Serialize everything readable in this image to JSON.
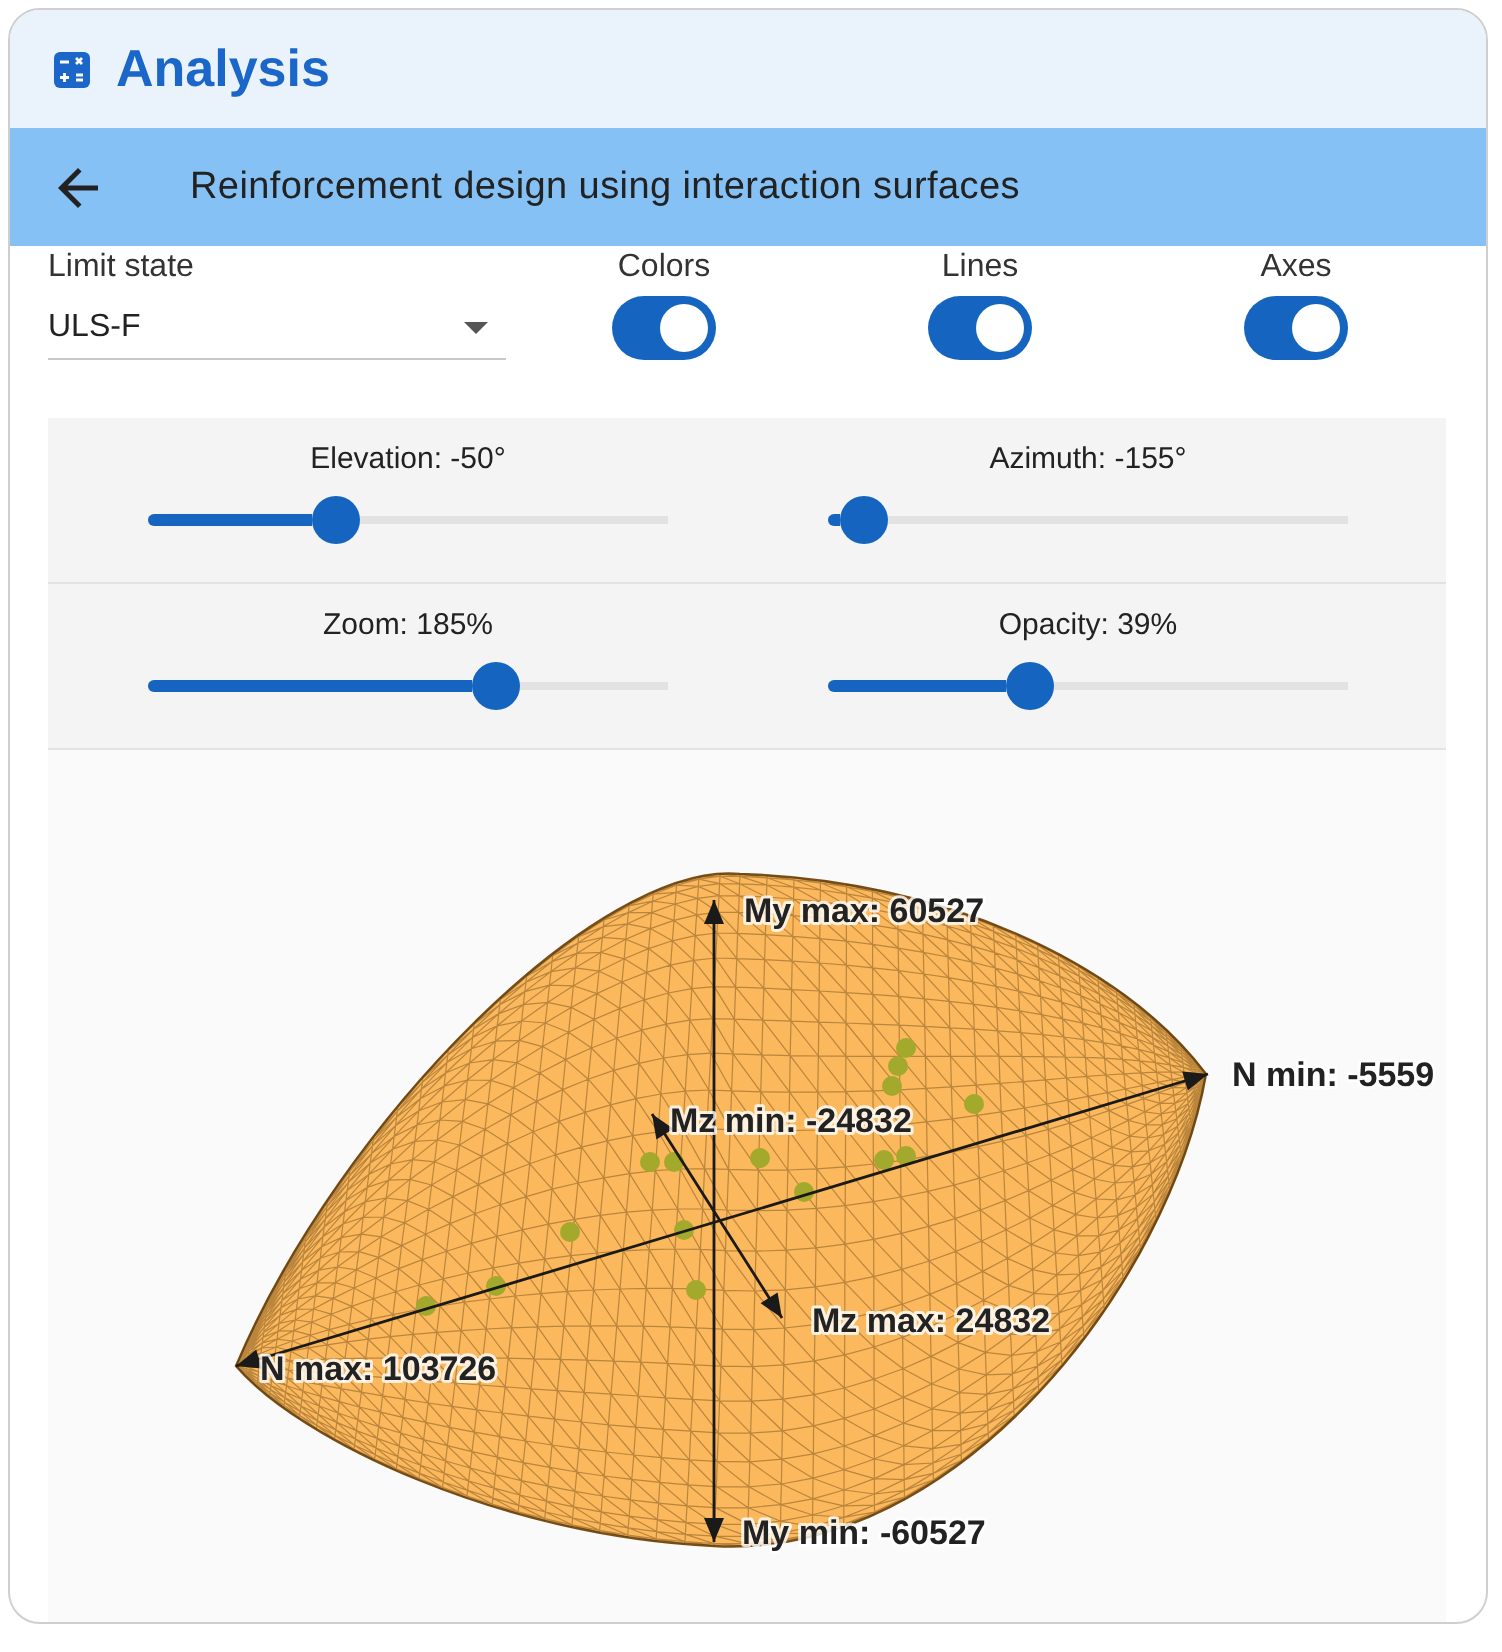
{
  "app": {
    "title": "Analysis"
  },
  "toolbar": {
    "title": "Reinforcement design using interaction surfaces"
  },
  "limit_state": {
    "label": "Limit state",
    "value": "ULS-F"
  },
  "toggles": [
    {
      "label": "Colors",
      "on": true
    },
    {
      "label": "Lines",
      "on": true
    },
    {
      "label": "Axes",
      "on": true
    }
  ],
  "sliders": [
    {
      "label": "Elevation: -50°",
      "level": 0.36
    },
    {
      "label": "Azimuth: -155°",
      "level": 0.07
    },
    {
      "label": "Zoom: 185%",
      "level": 0.67
    },
    {
      "label": "Opacity: 39%",
      "level": 0.39
    }
  ],
  "surface_view": {
    "axes": [
      {
        "max_label": "My max: 60527",
        "min_label": "My min: -60527"
      },
      {
        "max_label": "N max: 103726",
        "min_label": "N min: -5559"
      },
      {
        "max_label": "Mz max: 24832",
        "min_label": "Mz min: -24832"
      }
    ]
  }
}
